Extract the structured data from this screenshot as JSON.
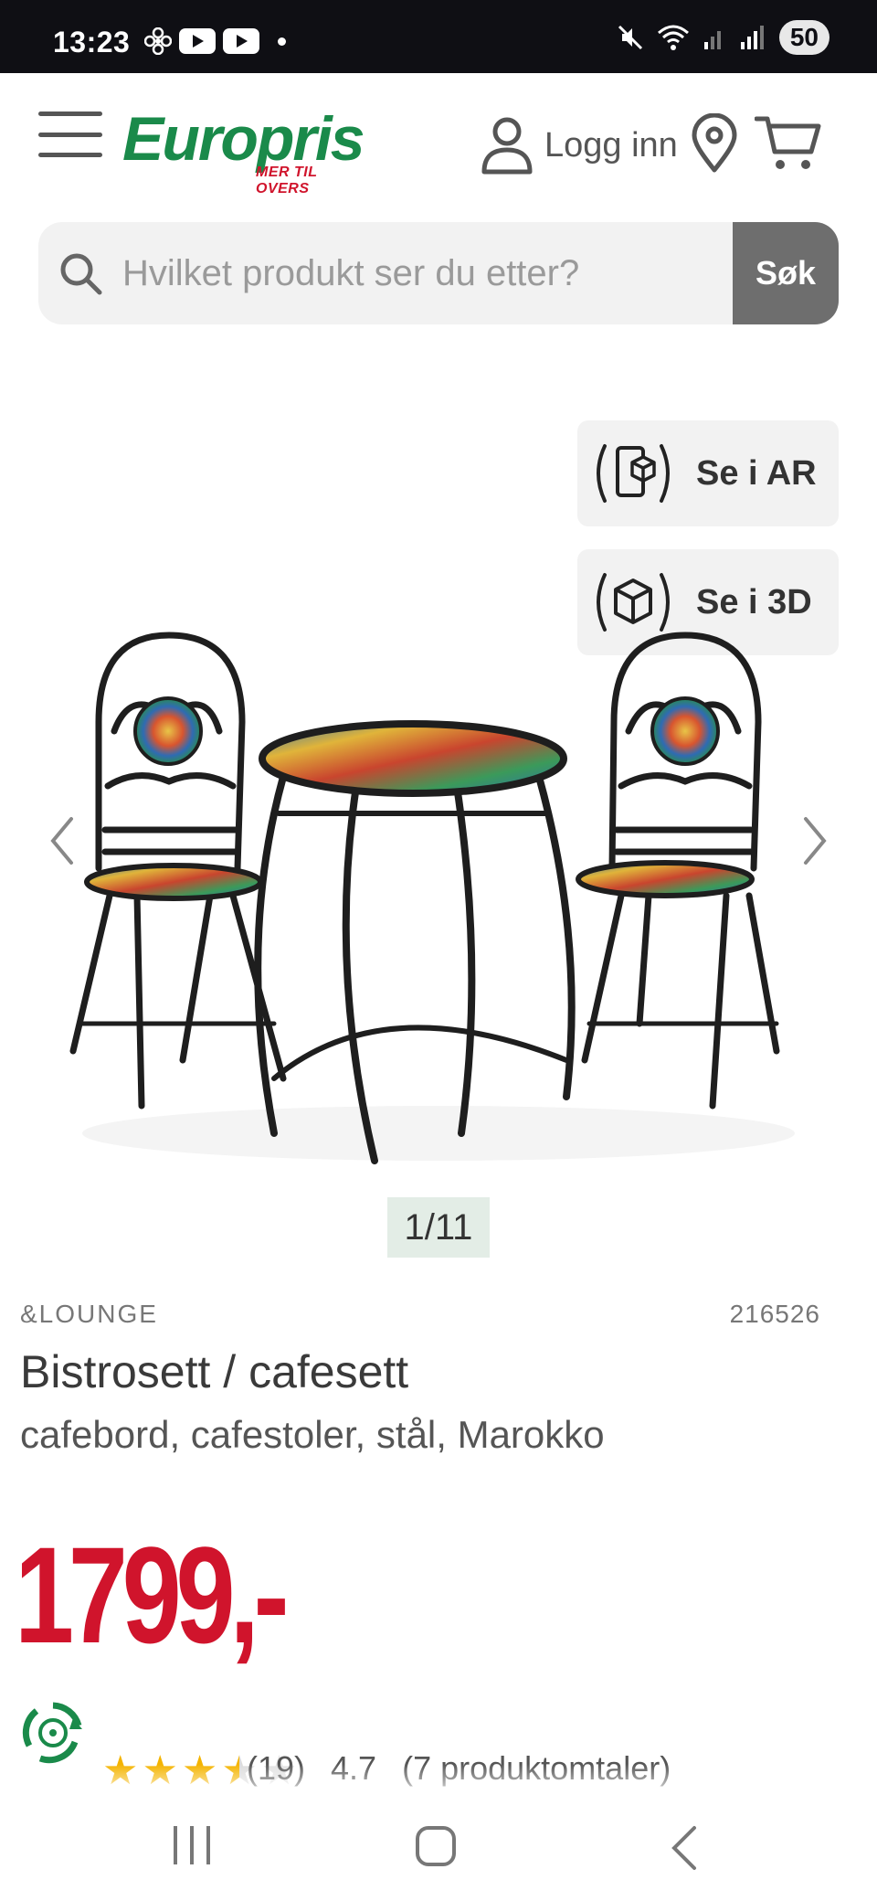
{
  "status_bar": {
    "time": "13:23",
    "battery": "50",
    "icons": [
      "fan-icon",
      "youtube-icon",
      "youtube-icon",
      "dot-icon",
      "mute-icon",
      "wifi-icon",
      "signal-icon",
      "signal-icon"
    ]
  },
  "header": {
    "logo_text": "Europris",
    "logo_tagline": "MER TIL OVERS",
    "login_label": "Logg inn",
    "icons": [
      "menu-icon",
      "user-icon",
      "location-pin-icon",
      "cart-icon"
    ]
  },
  "search": {
    "placeholder": "Hvilket produkt ser du etter?",
    "button_label": "Søk"
  },
  "view_buttons": {
    "ar_label": "Se i AR",
    "threed_label": "Se i 3D"
  },
  "gallery": {
    "counter": "1/11"
  },
  "product": {
    "brand": "&LOUNGE",
    "sku": "216526",
    "title": "Bistrosett / cafesett",
    "subtitle": "cafebord, cafestoler, stål, Marokko",
    "price": "1799,-",
    "rating_stars": 3.5,
    "rating_count": "(19)",
    "rating_value": "4.7",
    "reviews_label": "(7 produktomtaler)"
  },
  "colors": {
    "brand_green": "#1a8a4a",
    "price_red": "#d0142c",
    "search_button": "#6e6e6e",
    "counter_bg": "#e3ede6",
    "star": "#f4b400"
  }
}
